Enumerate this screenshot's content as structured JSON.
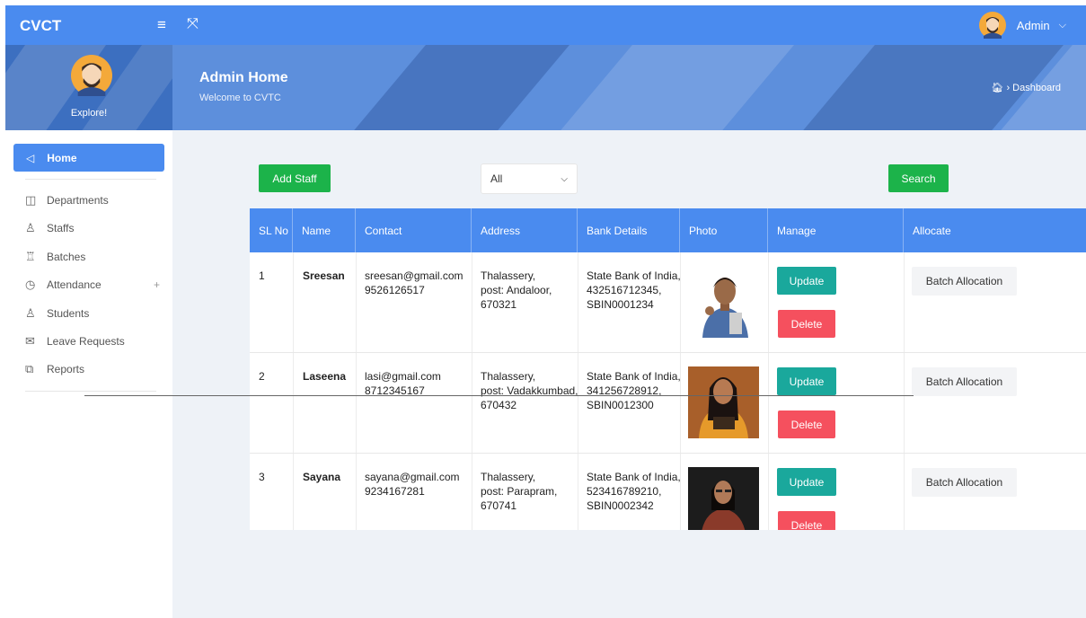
{
  "app": {
    "brand": "CVCT",
    "user_name": "Admin"
  },
  "sidebar": {
    "explore_label": "Explore!",
    "active_item": {
      "label": "Home",
      "icon": "megaphone-icon"
    },
    "items": [
      {
        "label": "Departments",
        "icon": "layout-icon"
      },
      {
        "label": "Staffs",
        "icon": "user-icon"
      },
      {
        "label": "Batches",
        "icon": "trophy-icon"
      },
      {
        "label": "Attendance",
        "icon": "clock-icon",
        "expand": "+"
      },
      {
        "label": "Students",
        "icon": "user-icon"
      },
      {
        "label": "Leave Requests",
        "icon": "mail-icon"
      },
      {
        "label": "Reports",
        "icon": "report-icon"
      }
    ]
  },
  "header": {
    "title": "Admin Home",
    "subtitle": "Welcome to CVTC",
    "breadcrumb": "Dashboard",
    "breadcrumb_sep": "›"
  },
  "toolbar": {
    "add_label": "Add Staff",
    "filter_value": "All",
    "search_label": "Search"
  },
  "table": {
    "columns": [
      "SL No",
      "Name",
      "Contact",
      "Address",
      "Bank Details",
      "Photo",
      "Manage",
      "Allocate"
    ],
    "rows": [
      {
        "sl": "1",
        "name": "Sreesan",
        "email": "sreesan@gmail.com",
        "phone": "9526126517",
        "addr1": "Thalassery,",
        "addr2": "post: Andaloor,",
        "addr3": "670321",
        "bank1": "State Bank of India,",
        "bank2": "432516712345,",
        "bank3": "SBIN0001234",
        "update": "Update",
        "delete": "Delete",
        "allocate": "Batch Allocation"
      },
      {
        "sl": "2",
        "name": "Laseena",
        "email": "lasi@gmail.com",
        "phone": "8712345167",
        "addr1": "Thalassery,",
        "addr2": "post: Vadakkumbad,",
        "addr3": "670432",
        "bank1": "State Bank of India,",
        "bank2": "341256728912,",
        "bank3": "SBIN0012300",
        "update": "Update",
        "delete": "Delete",
        "allocate": "Batch Allocation"
      },
      {
        "sl": "3",
        "name": "Sayana",
        "email": "sayana@gmail.com",
        "phone": "9234167281",
        "addr1": "Thalassery,",
        "addr2": "post: Parapram,",
        "addr3": "670741",
        "bank1": "State Bank of India,",
        "bank2": "523416789210,",
        "bank3": "SBIN0002342",
        "update": "Update",
        "delete": "Delete",
        "allocate": "Batch Allocation"
      }
    ]
  },
  "colors": {
    "primary": "#4a8bef",
    "green": "#1cb34a",
    "teal": "#1aa89c",
    "red": "#f5505e"
  }
}
